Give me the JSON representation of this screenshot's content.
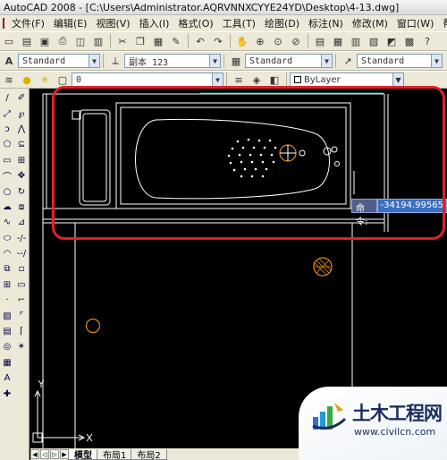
{
  "window": {
    "title": "AutoCAD 2008 - [C:\\Users\\Administrator.AQRVNNXCYYE24YD\\Desktop\\4-13.dwg]"
  },
  "menu": {
    "items": [
      "文件(F)",
      "编辑(E)",
      "视图(V)",
      "插入(I)",
      "格式(O)",
      "工具(T)",
      "绘图(D)",
      "标注(N)",
      "修改(M)",
      "窗口(W)",
      "帮助(H)"
    ]
  },
  "styles_toolbar": {
    "text_style": "Standard",
    "dim_style": "副本 123",
    "table_style": "Standard",
    "multileader_style": "Standard"
  },
  "layers_toolbar": {
    "current_layer": "0",
    "color": "ByLayer"
  },
  "command": {
    "label": "命令:",
    "value": "-34194.99565"
  },
  "layout_tabs": [
    "模型",
    "布局1",
    "布局2"
  ],
  "watermark": {
    "title": "土木工程网",
    "url": "www.civilcn.com"
  },
  "colors": {
    "highlight": "#e0202a",
    "canvas": "#000000",
    "drawing_lines": "#ffffff",
    "circle_accent": "#e08a1e"
  },
  "icons": {
    "toolbar1": [
      "new-icon",
      "open-icon",
      "save-icon",
      "print-icon",
      "preview-icon",
      "publish-icon",
      "cut-icon",
      "copy-icon",
      "paste-icon",
      "matchprop-icon",
      "undo-icon",
      "redo-icon",
      "pan-icon",
      "zoom-realtime-icon",
      "zoom-window-icon",
      "zoom-previous-icon",
      "properties-icon",
      "designcenter-icon",
      "toolpalettes-icon",
      "sheetset-icon",
      "markup-icon",
      "calculator-icon",
      "help-icon"
    ],
    "draw_toolbar": [
      "line-icon",
      "xline-icon",
      "polyline-icon",
      "polygon-icon",
      "rectangle-icon",
      "arc-icon",
      "circle-icon",
      "revcloud-icon",
      "spline-icon",
      "ellipse-icon",
      "ellipse-arc-icon",
      "insert-block-icon",
      "make-block-icon",
      "point-icon",
      "hatch-icon",
      "gradient-icon",
      "region-icon",
      "table-icon",
      "mtext-icon",
      "add-selected-icon"
    ],
    "modify_toolbar": [
      "erase-icon",
      "copy-object-icon",
      "mirror-icon",
      "offset-icon",
      "array-icon",
      "move-icon",
      "rotate-icon",
      "scale-icon",
      "stretch-icon",
      "trim-icon",
      "extend-icon",
      "break-at-point-icon",
      "break-icon",
      "join-icon",
      "chamfer-icon",
      "fillet-icon",
      "explode-icon"
    ]
  }
}
